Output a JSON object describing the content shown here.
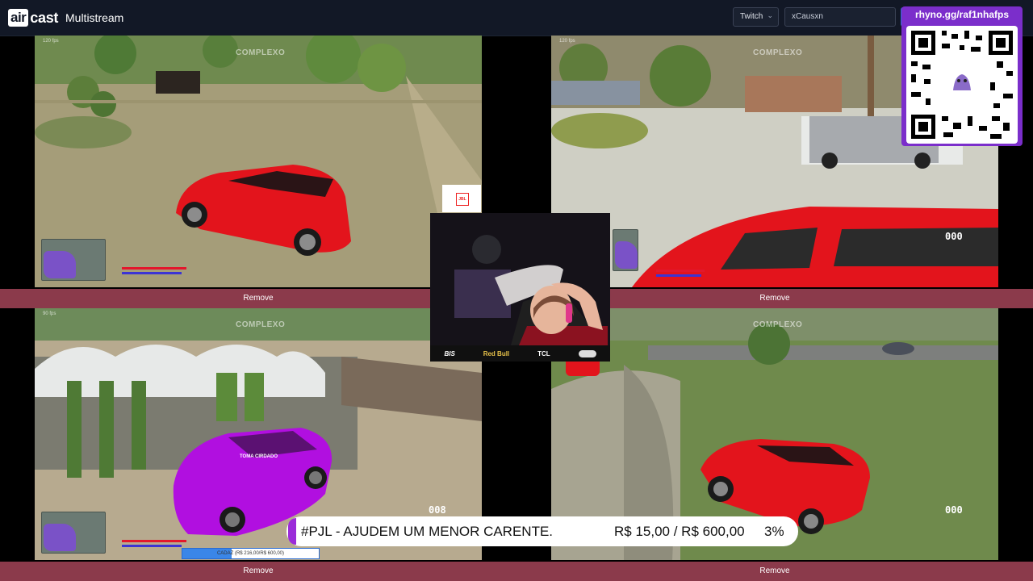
{
  "app": {
    "logo_a": "air",
    "logo_b": "cast",
    "title": "Multistream"
  },
  "controls": {
    "platform": "Twitch",
    "channel_value": "xCausxn"
  },
  "streams": [
    {
      "remove_label": "Remove",
      "watermark": "COMPLEXO",
      "fps": "120 fps"
    },
    {
      "remove_label": "Remove",
      "watermark": "COMPLEXO",
      "fps": "120 fps"
    },
    {
      "remove_label": "Remove",
      "watermark": "COMPLEXO",
      "fps": "90 fps"
    },
    {
      "remove_label": "Remove",
      "watermark": "COMPLEXO"
    }
  ],
  "overlays": {
    "qr_url": "rhyno.gg/raf1nhafps",
    "sponsors": [
      "BIS",
      "Red Bull",
      "TCL",
      ""
    ],
    "jbl": "JBL",
    "player_tag": "TOMA CIRDADO",
    "donation_title": "#PJL - AJUDEM UM MENOR CARENTE.",
    "donation_amount": "R$ 15,00 / R$ 600,00",
    "donation_percent": "3%",
    "donation_progress": 0.03,
    "goal_strip": "CADAZ (R$ 216,00/R$ 600,00)",
    "goal_strip_progress": 0.36
  },
  "colors": {
    "topbar": "#121826",
    "remove_bar": "#8b3a4b",
    "accent": "#7b2ecb",
    "car_red": "#e3141c",
    "car_purple": "#b10fe0"
  }
}
